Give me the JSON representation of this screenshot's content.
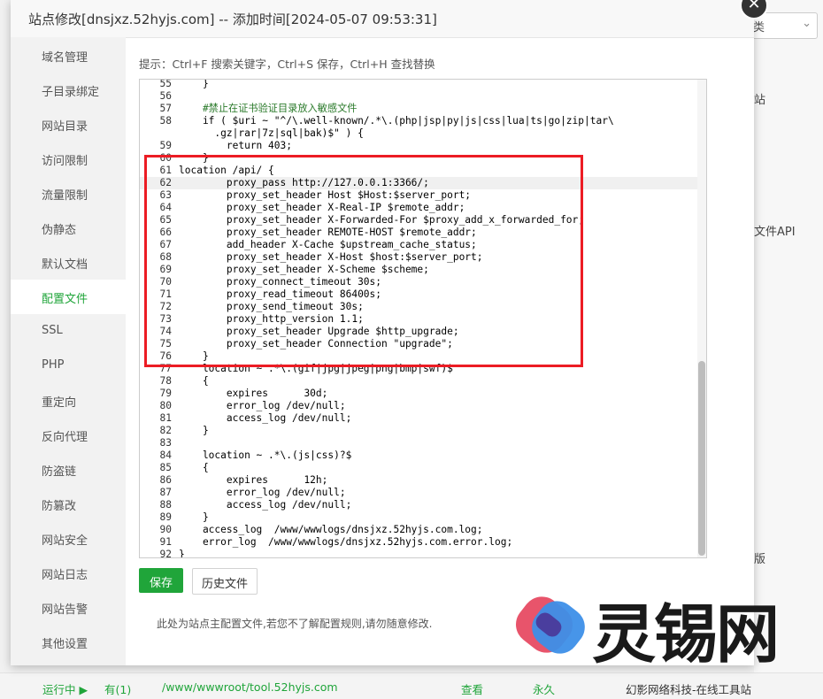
{
  "background": {
    "select_label": "类",
    "right_texts": [
      "站",
      "文件API",
      "版"
    ],
    "bottom": {
      "status": "运行中 ▶",
      "backup": "有(1)",
      "path": "/www/wwwroot/tool.52hyjs.com",
      "view": "查看",
      "expire": "永久",
      "remark": "幻影网络科技-在线工具站"
    }
  },
  "modal": {
    "title": "站点修改[dnsjxz.52hyjs.com] -- 添加时间[2024-05-07 09:53:31]",
    "close_glyph": "✕",
    "hint": "提示：Ctrl+F 搜索关键字，Ctrl+S 保存，Ctrl+H 查找替换",
    "save_label": "保存",
    "history_label": "历史文件",
    "note": "此处为站点主配置文件,若您不了解配置规则,请勿随意修改."
  },
  "sidebar": {
    "items": [
      {
        "label": "域名管理"
      },
      {
        "label": "子目录绑定"
      },
      {
        "label": "网站目录"
      },
      {
        "label": "访问限制"
      },
      {
        "label": "流量限制"
      },
      {
        "label": "伪静态"
      },
      {
        "label": "默认文档"
      },
      {
        "label": "配置文件"
      },
      {
        "label": "SSL"
      },
      {
        "label": "PHP"
      },
      {
        "label": "重定向"
      },
      {
        "label": "反向代理"
      },
      {
        "label": "防盗链"
      },
      {
        "label": "防篡改"
      },
      {
        "label": "网站安全"
      },
      {
        "label": "网站日志"
      },
      {
        "label": "网站告警"
      },
      {
        "label": "其他设置"
      }
    ],
    "active_index": 7
  },
  "editor": {
    "lines": [
      {
        "n": "55",
        "t": "    }"
      },
      {
        "n": "56",
        "t": ""
      },
      {
        "n": "57",
        "t": "    #禁止在证书验证目录放入敏感文件"
      },
      {
        "n": "58",
        "t": "    if ( $uri ~ \"^/\\.well-known/.*\\.(php|jsp|py|js|css|lua|ts|go|zip|tar\\"
      },
      {
        "n": "",
        "t": "      .gz|rar|7z|sql|bak)$\" ) {"
      },
      {
        "n": "59",
        "t": "        return 403;"
      },
      {
        "n": "60",
        "t": "    }"
      },
      {
        "n": "61",
        "t": "location /api/ {"
      },
      {
        "n": "62",
        "t": "        proxy_pass http://127.0.0.1:3366/;"
      },
      {
        "n": "63",
        "t": "        proxy_set_header Host $Host:$server_port;"
      },
      {
        "n": "64",
        "t": "        proxy_set_header X-Real-IP $remote_addr;"
      },
      {
        "n": "65",
        "t": "        proxy_set_header X-Forwarded-For $proxy_add_x_forwarded_for;"
      },
      {
        "n": "66",
        "t": "        proxy_set_header REMOTE-HOST $remote_addr;"
      },
      {
        "n": "67",
        "t": "        add_header X-Cache $upstream_cache_status;"
      },
      {
        "n": "68",
        "t": "        proxy_set_header X-Host $host:$server_port;"
      },
      {
        "n": "69",
        "t": "        proxy_set_header X-Scheme $scheme;"
      },
      {
        "n": "70",
        "t": "        proxy_connect_timeout 30s;"
      },
      {
        "n": "71",
        "t": "        proxy_read_timeout 86400s;"
      },
      {
        "n": "72",
        "t": "        proxy_send_timeout 30s;"
      },
      {
        "n": "73",
        "t": "        proxy_http_version 1.1;"
      },
      {
        "n": "74",
        "t": "        proxy_set_header Upgrade $http_upgrade;"
      },
      {
        "n": "75",
        "t": "        proxy_set_header Connection \"upgrade\";"
      },
      {
        "n": "76",
        "t": "    }"
      },
      {
        "n": "77",
        "t": "    location ~ .*\\.(gif|jpg|jpeg|png|bmp|swf)$"
      },
      {
        "n": "78",
        "t": "    {"
      },
      {
        "n": "79",
        "t": "        expires      30d;"
      },
      {
        "n": "80",
        "t": "        error_log /dev/null;"
      },
      {
        "n": "81",
        "t": "        access_log /dev/null;"
      },
      {
        "n": "82",
        "t": "    }"
      },
      {
        "n": "83",
        "t": ""
      },
      {
        "n": "84",
        "t": "    location ~ .*\\.(js|css)?$"
      },
      {
        "n": "85",
        "t": "    {"
      },
      {
        "n": "86",
        "t": "        expires      12h;"
      },
      {
        "n": "87",
        "t": "        error_log /dev/null;"
      },
      {
        "n": "88",
        "t": "        access_log /dev/null;"
      },
      {
        "n": "89",
        "t": "    }"
      },
      {
        "n": "90",
        "t": "    access_log  /www/wwwlogs/dnsjxz.52hyjs.com.log;"
      },
      {
        "n": "91",
        "t": "    error_log  /www/wwwlogs/dnsjxz.52hyjs.com.error.log;"
      },
      {
        "n": "92",
        "t": "}"
      }
    ],
    "current_line": 8
  },
  "watermark": {
    "text": "灵锡网",
    "colors": {
      "pink": "#e8546b",
      "blue": "#3d8fe8",
      "dark": "#1a1a1a"
    }
  },
  "colors": {
    "accent": "#20a53a",
    "highlight_box": "#ec1c24"
  }
}
